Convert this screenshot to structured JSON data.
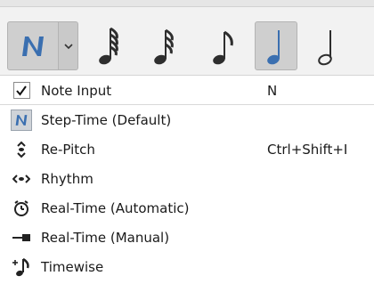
{
  "toolbar": {
    "main_button_icon": "step-time-n-icon",
    "dropdown_icon": "chevron-down-icon",
    "notes": [
      {
        "icon": "sixty-fourth-note-icon",
        "active": false
      },
      {
        "icon": "thirty-second-note-icon",
        "active": false
      },
      {
        "icon": "sixteenth-note-icon",
        "active": false
      },
      {
        "icon": "eighth-note-icon",
        "active": false
      },
      {
        "icon": "quarter-note-icon",
        "active": true
      },
      {
        "icon": "half-note-icon",
        "active": false
      }
    ],
    "accent_color": "#3a6fb0"
  },
  "menu": {
    "items": [
      {
        "label": "Note Input",
        "shortcut": "N",
        "icon": "checkbox-checked-icon",
        "checked": true
      },
      {
        "label": "Step-Time (Default)",
        "shortcut": "",
        "icon": "step-time-icon"
      },
      {
        "label": "Re-Pitch",
        "shortcut": "Ctrl+Shift+I",
        "icon": "re-pitch-icon"
      },
      {
        "label": "Rhythm",
        "shortcut": "",
        "icon": "rhythm-icon"
      },
      {
        "label": "Real-Time (Automatic)",
        "shortcut": "",
        "icon": "stopwatch-icon"
      },
      {
        "label": "Real-Time (Manual)",
        "shortcut": "",
        "icon": "real-time-manual-icon"
      },
      {
        "label": "Timewise",
        "shortcut": "",
        "icon": "timewise-icon"
      }
    ]
  }
}
